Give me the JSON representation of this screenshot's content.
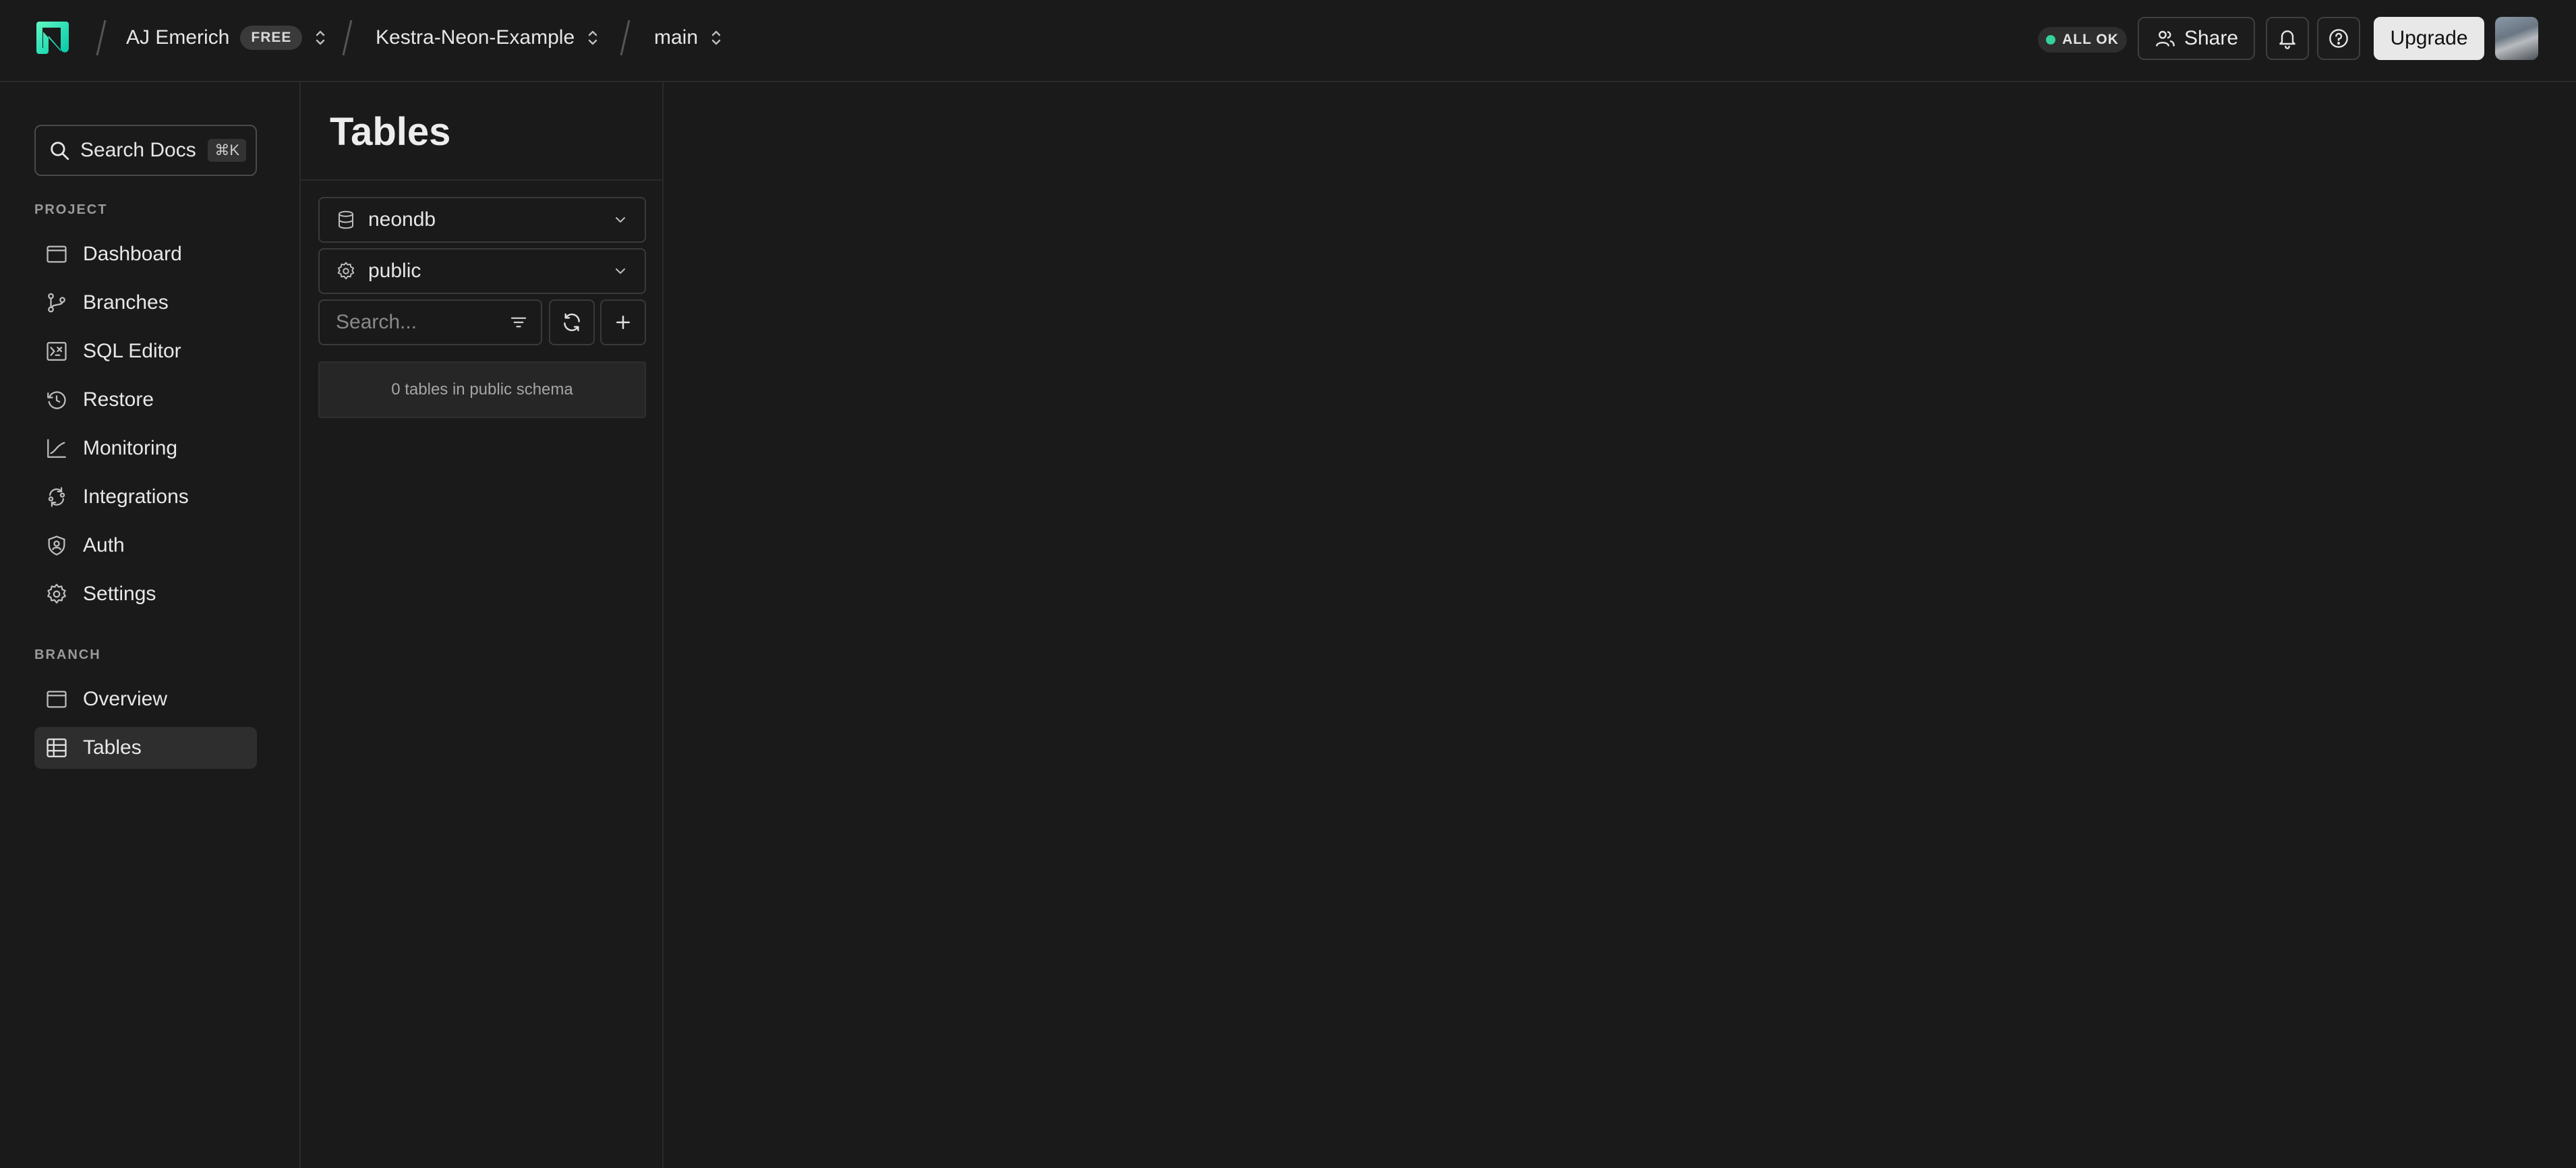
{
  "header": {
    "org": {
      "name": "AJ Emerich",
      "plan_badge": "FREE"
    },
    "project": {
      "name": "Kestra-Neon-Example"
    },
    "branch": {
      "name": "main"
    },
    "status": {
      "label": "ALL OK",
      "color": "#34d399"
    },
    "share_label": "Share",
    "upgrade_label": "Upgrade",
    "icons": {
      "logo": "neon-logo-icon",
      "notifications": "bell-icon",
      "help": "help-circle-icon"
    }
  },
  "sidebar": {
    "search": {
      "label": "Search Docs",
      "shortcut": "⌘K"
    },
    "project_section": {
      "label": "PROJECT",
      "items": [
        {
          "label": "Dashboard",
          "icon": "dashboard-icon"
        },
        {
          "label": "Branches",
          "icon": "branches-icon"
        },
        {
          "label": "SQL Editor",
          "icon": "sql-editor-icon"
        },
        {
          "label": "Restore",
          "icon": "restore-icon"
        },
        {
          "label": "Monitoring",
          "icon": "monitoring-icon"
        },
        {
          "label": "Integrations",
          "icon": "integrations-icon"
        },
        {
          "label": "Auth",
          "icon": "auth-icon"
        },
        {
          "label": "Settings",
          "icon": "gear-icon"
        }
      ]
    },
    "branch_section": {
      "label": "BRANCH",
      "items": [
        {
          "label": "Overview",
          "icon": "overview-icon"
        },
        {
          "label": "Tables",
          "icon": "tables-icon",
          "active": true
        }
      ]
    }
  },
  "tables_panel": {
    "title": "Tables",
    "database_select": {
      "value": "neondb",
      "icon": "database-icon"
    },
    "schema_select": {
      "value": "public",
      "icon": "schema-icon"
    },
    "search": {
      "placeholder": "Search..."
    },
    "empty_message": "0 tables in public schema"
  },
  "colors": {
    "background": "#1a1a1a",
    "accent": "#34d399",
    "brand_logo": "#00e5bf"
  }
}
